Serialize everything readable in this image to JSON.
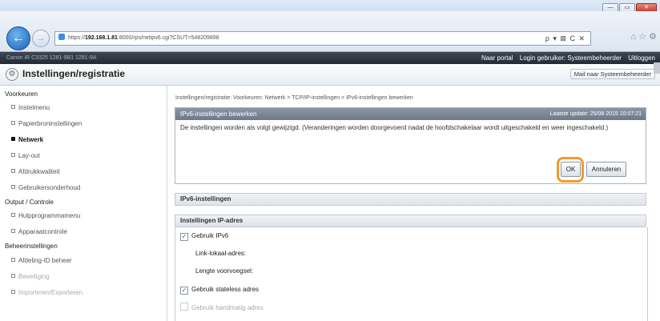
{
  "browser": {
    "address_prefix": "https://",
    "address_host": "192.168.1.81",
    "address_rest": ":8000/rps/netipv6.cgi?CSUT=548209898",
    "address_tools": "ρ ▾ ⊠ C ✕",
    "nav_icons": "⌂ ☆ ⚙"
  },
  "window": {
    "minimize": "—",
    "maximize": "▭",
    "close": "✕"
  },
  "topbar": {
    "device_name": "Canon iR C3325  1281-9B1 1281-9A",
    "links": [
      "Naar portal",
      "Login gebruiker: Systeembeheerder",
      "Uitloggen"
    ]
  },
  "header": {
    "title": "Instellingen/registratie",
    "mail_link": "Mail naar Systeembeheerder"
  },
  "sidebar": {
    "groups": [
      {
        "label": "Voorkeuren",
        "items": [
          {
            "label": "Instelmenu",
            "state": "normal"
          },
          {
            "label": "Papierbroninstellingen",
            "state": "normal"
          },
          {
            "label": "Netwerk",
            "state": "active"
          },
          {
            "label": "Lay-out",
            "state": "normal"
          },
          {
            "label": "Afdrukkwaliteit",
            "state": "normal"
          },
          {
            "label": "Gebruikersonderhoud",
            "state": "normal"
          }
        ]
      },
      {
        "label": "Output / Controle",
        "items": [
          {
            "label": "Hulpprogrammamenu",
            "state": "normal"
          },
          {
            "label": "Apparaatcontrole",
            "state": "normal"
          }
        ]
      },
      {
        "label": "Beheerinstellingen",
        "items": [
          {
            "label": "Afdeling-ID beheer",
            "state": "normal"
          },
          {
            "label": "Beveiliging",
            "state": "faded"
          },
          {
            "label": "Importeren/Exporteren",
            "state": "faded"
          }
        ]
      }
    ]
  },
  "breadcrumb": "Instellingen/registratie: Voorkeuren: Netwerk > TCP/IP-instellingen > IPv6-instellingen bewerken",
  "edit_panel": {
    "title": "IPv6-instellingen bewerken",
    "last_update": "Laatste update: 25/08 2015 10:07:21",
    "message": "De instellingen worden als volgt gewijzigd. (Veranderingen worden doorgevoerd nadat de hoofdschakelaar wordt uitgeschakeld en weer ingeschakeld.)",
    "ok_label": "OK",
    "cancel_label": "Annuleren"
  },
  "sections": {
    "ipv6_settings": "IPv6-instellingen",
    "ip_address_settings": "Instellingen IP-adres"
  },
  "settings_rows": {
    "use_ipv6": {
      "label": "Gebruik IPv6",
      "checked": true
    },
    "link_local": "Link-lokaal-adres:",
    "prefix_length": "Lengte voorvoegsel:",
    "stateless": {
      "label": "Gebruik stateless adres",
      "checked": true
    },
    "manual": {
      "label": "Gebruik handmatig adres",
      "checked": false
    }
  },
  "colors": {
    "topbar_bg": "#2a323d",
    "panel_head_bg": "#7a8695",
    "highlight_ring": "#f39b2b",
    "back_button": "#1b62b6"
  }
}
